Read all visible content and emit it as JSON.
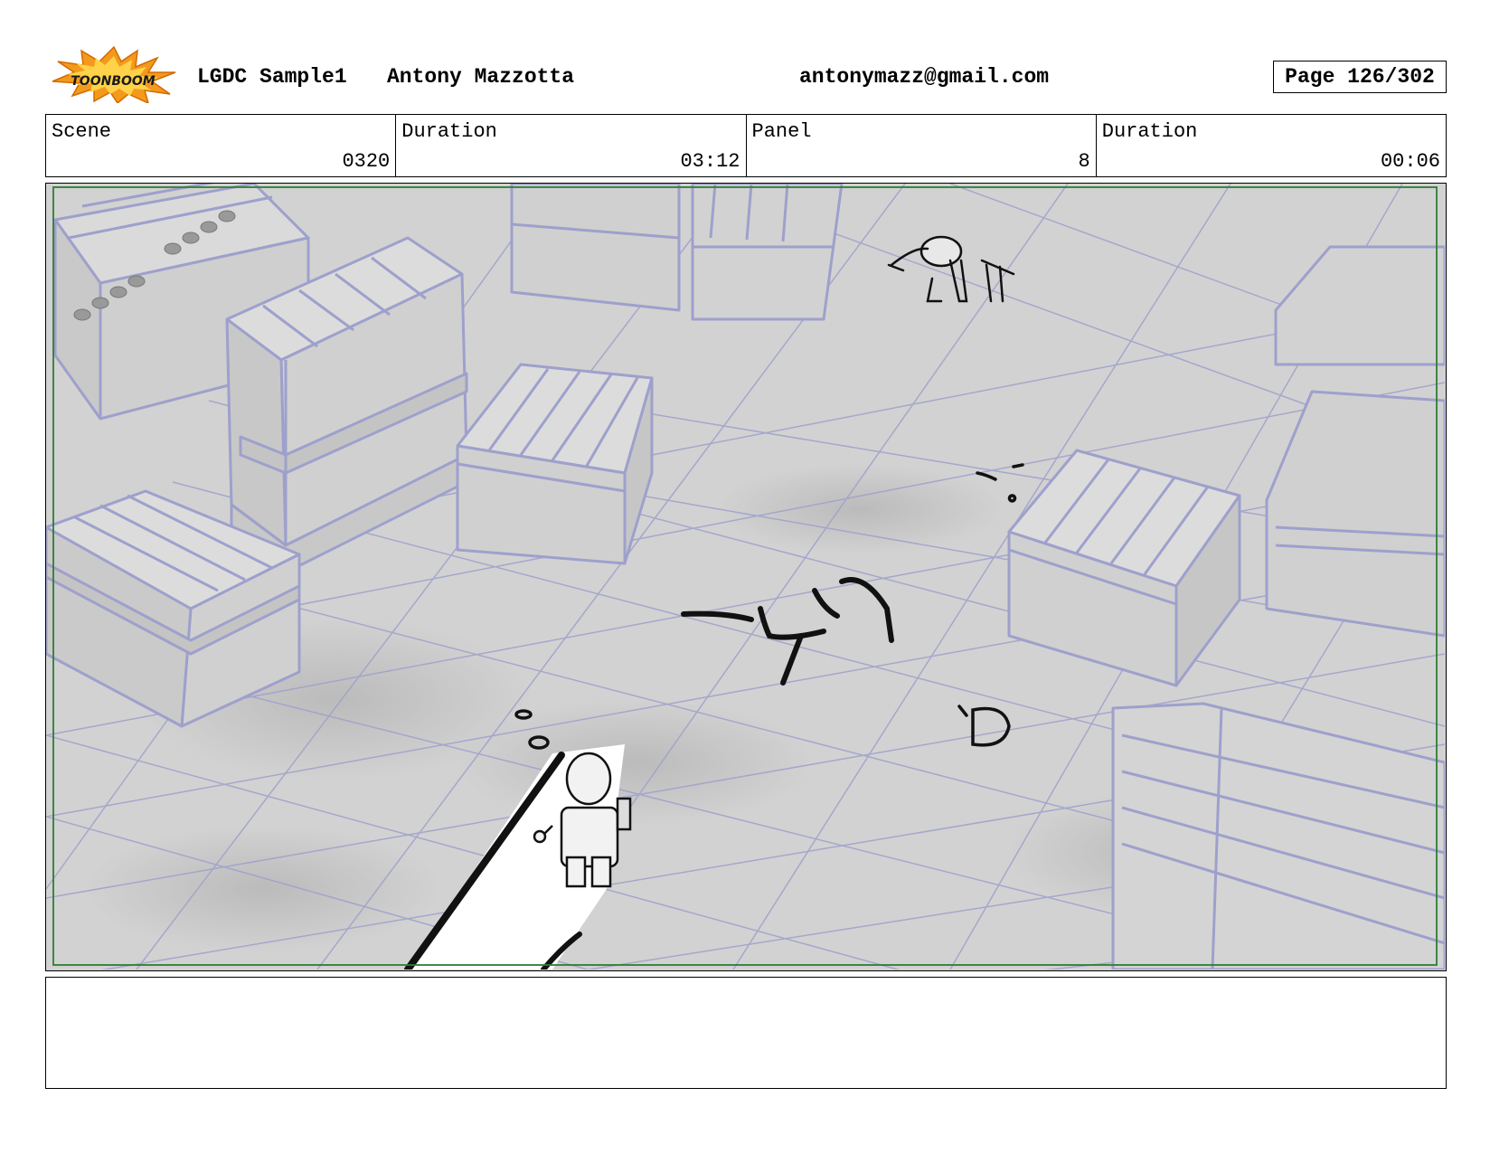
{
  "header": {
    "logo_text": "TOONBOOM",
    "project": "LGDC Sample1",
    "author": "Antony Mazzotta",
    "email": "antonymazz@gmail.com",
    "page": "Page 126/302"
  },
  "info": {
    "scene_label": "Scene",
    "scene_value": "0320",
    "scene_duration_label": "Duration",
    "scene_duration_value": "03:12",
    "panel_label": "Panel",
    "panel_value": "8",
    "panel_duration_label": "Duration",
    "panel_duration_value": "00:06"
  },
  "colors": {
    "line_art": "#9ea0cc",
    "floor": "#d2d2d2",
    "safe_frame": "#2e7d32",
    "logo_orange": "#f39a1d"
  },
  "notes": {
    "text": ""
  }
}
